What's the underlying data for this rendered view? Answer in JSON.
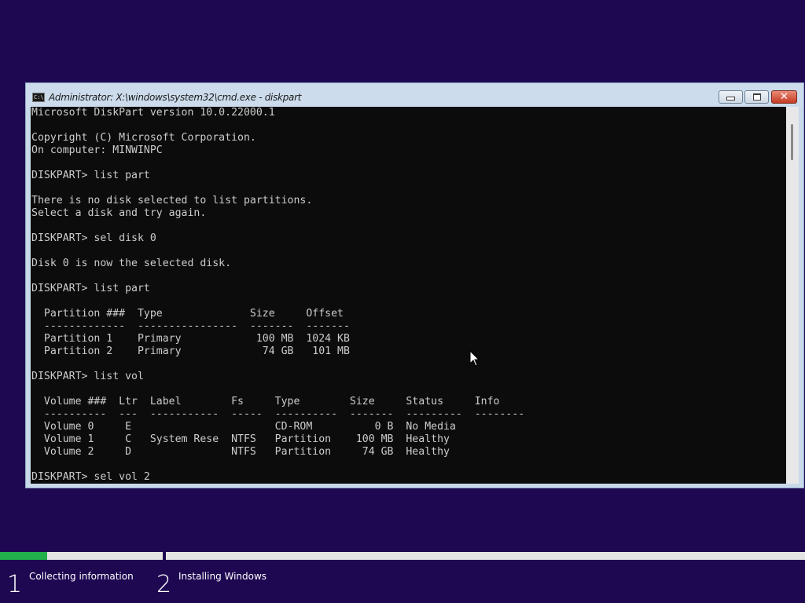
{
  "window": {
    "title": "Administrator: X:\\windows\\system32\\cmd.exe - diskpart",
    "icon": "cmd-icon",
    "title_icon_text": "C:\\",
    "minimize_icon": "minimize-icon",
    "maximize_icon": "maximize-icon",
    "close_icon": "close-icon",
    "close_glyph": "✕"
  },
  "console": {
    "lines": [
      "Microsoft DiskPart version 10.0.22000.1",
      "",
      "Copyright (C) Microsoft Corporation.",
      "On computer: MINWINPC",
      "",
      "DISKPART> list part",
      "",
      "There is no disk selected to list partitions.",
      "Select a disk and try again.",
      "",
      "DISKPART> sel disk 0",
      "",
      "Disk 0 is now the selected disk.",
      "",
      "DISKPART> list part",
      "",
      "  Partition ###  Type              Size     Offset",
      "  -------------  ----------------  -------  -------",
      "  Partition 1    Primary            100 MB  1024 KB",
      "  Partition 2    Primary             74 GB   101 MB",
      "",
      "DISKPART> list vol",
      "",
      "  Volume ###  Ltr  Label        Fs     Type        Size     Status     Info",
      "  ----------  ---  -----------  -----  ----------  -------  ---------  --------",
      "  Volume 0     E                       CD-ROM          0 B  No Media",
      "  Volume 1     C   System Rese  NTFS   Partition    100 MB  Healthy",
      "  Volume 2     D                NTFS   Partition     74 GB  Healthy",
      "",
      "DISKPART> sel vol 2"
    ]
  },
  "setup": {
    "progress_fraction_step1": 0.29,
    "progress_color": "#21b04b",
    "steps": [
      {
        "number": "1",
        "label": "Collecting information"
      },
      {
        "number": "2",
        "label": "Installing Windows"
      }
    ]
  },
  "cursor": {
    "icon": "mouse-pointer-icon"
  },
  "colors": {
    "background": "#1e0852",
    "console_bg": "#0c0c0c",
    "console_fg": "#cccccc",
    "titlebar": "#ccdcec"
  }
}
